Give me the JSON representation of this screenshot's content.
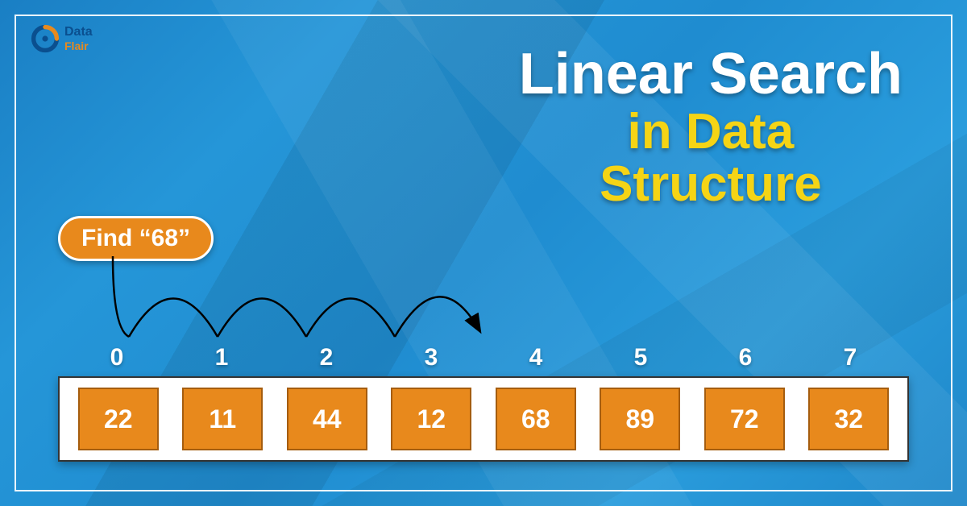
{
  "logo": {
    "top": "Data",
    "bottom": "Flair"
  },
  "title": {
    "line1": "Linear Search",
    "line2": "in Data",
    "line3": "Structure"
  },
  "find_label": "Find “68”",
  "array": {
    "indices": [
      "0",
      "1",
      "2",
      "3",
      "4",
      "5",
      "6",
      "7"
    ],
    "values": [
      "22",
      "11",
      "44",
      "12",
      "68",
      "89",
      "72",
      "32"
    ]
  },
  "search_path_end_index": 4,
  "colors": {
    "bg_blue": "#2291d4",
    "accent_orange": "#e8891c",
    "title_yellow": "#f5d415"
  }
}
